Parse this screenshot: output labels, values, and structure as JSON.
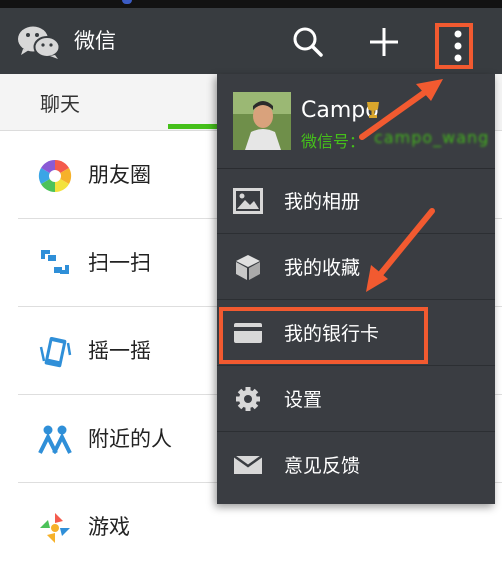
{
  "header": {
    "title": "微信"
  },
  "tabs": [
    {
      "label": "聊天"
    }
  ],
  "discover_items": [
    {
      "label": "朋友圈",
      "icon": "moments-icon"
    },
    {
      "label": "扫一扫",
      "icon": "scan-icon"
    },
    {
      "label": "摇一摇",
      "icon": "shake-icon"
    },
    {
      "label": "附近的人",
      "icon": "people-nearby-icon"
    },
    {
      "label": "游戏",
      "icon": "games-icon"
    }
  ],
  "menu": {
    "profile": {
      "name": "Campo",
      "wechat_id_label": "微信号：",
      "wechat_id_value": "campo_wang"
    },
    "items": [
      {
        "label": "我的相册",
        "icon": "album-icon"
      },
      {
        "label": "我的收藏",
        "icon": "favorites-icon"
      },
      {
        "label": "我的银行卡",
        "icon": "bank-card-icon"
      },
      {
        "label": "设置",
        "icon": "settings-icon"
      },
      {
        "label": "意见反馈",
        "icon": "feedback-icon"
      }
    ]
  },
  "colors": {
    "topbar": "#383c40",
    "menu": "#3a3d42",
    "accent_green": "#45c01a",
    "highlight": "#f25a30"
  }
}
